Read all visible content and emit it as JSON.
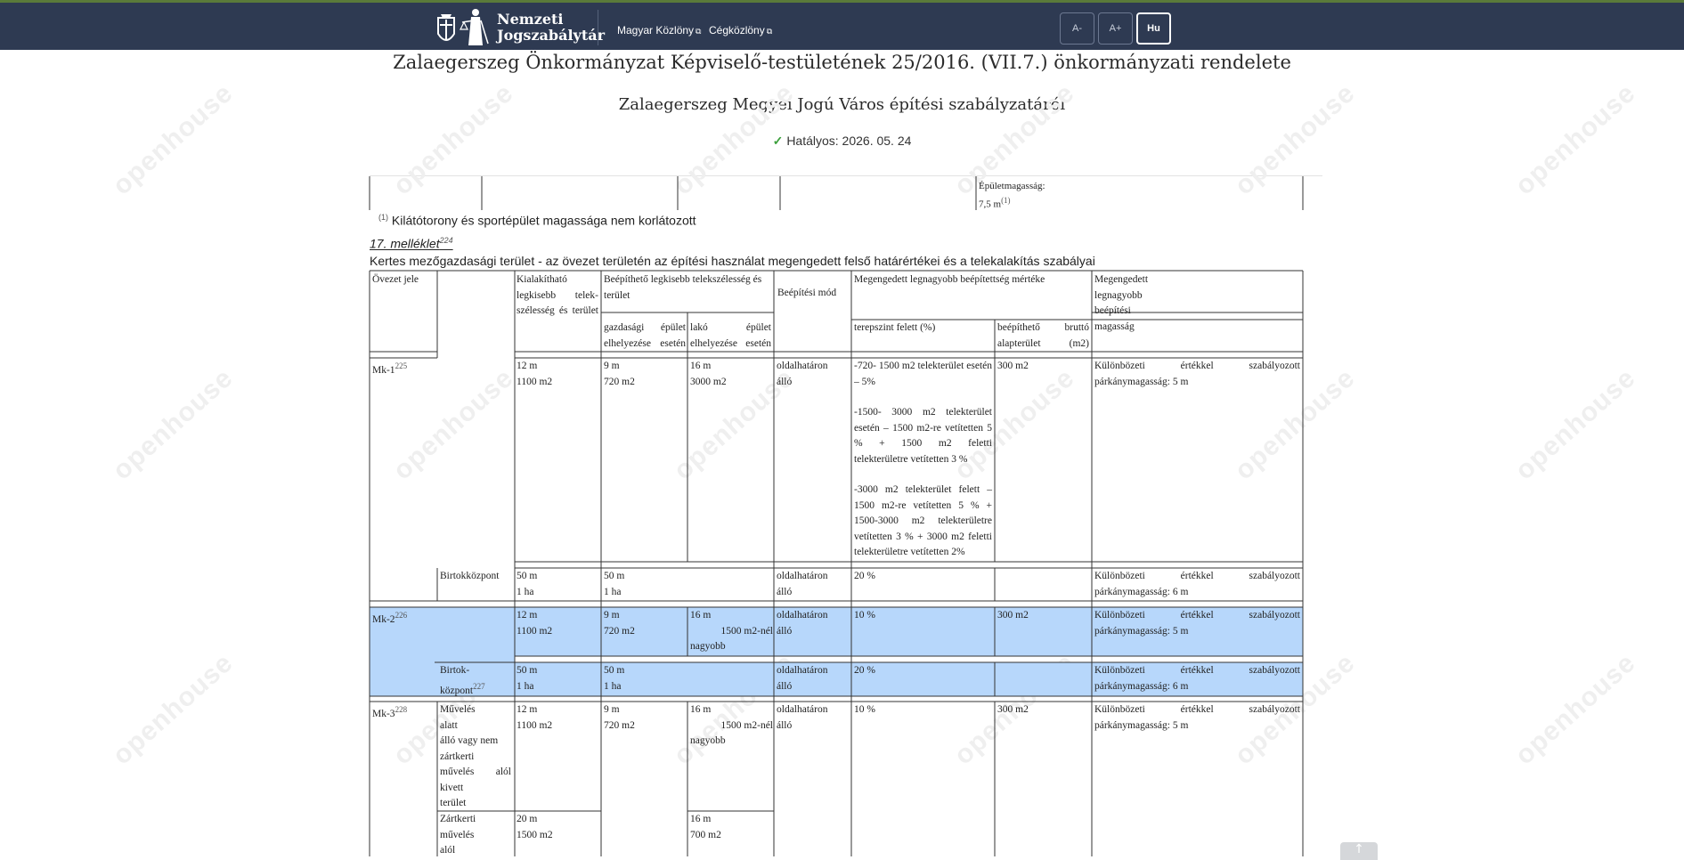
{
  "header": {
    "logo_line1": "Nemzeti",
    "logo_line2": "Jogszabálytár",
    "links": [
      "Magyar Közlöny",
      "Cégközlöny"
    ],
    "font_buttons": [
      "A-",
      "A+",
      "Hu"
    ]
  },
  "document": {
    "title": "Zalaegerszeg Önkormányzat Képviselő-testületének 25/2016. (VII.7.) önkormányzati rendelete",
    "subtitle": "Zalaegerszeg Megyei Jogú Város építési szabályzatáról",
    "status": "Hatályos: 2026. 05. 24"
  },
  "previous_table_tail": {
    "height_label": "Épületmagasság:",
    "height_value": "7,5 m",
    "height_note": "(1)"
  },
  "footnote": {
    "mark": "(1)",
    "text": "Kilátótorony és sportépület magassága nem korlátozott"
  },
  "annex": {
    "label": "17. melléklet",
    "ref": "224",
    "title": "Kertes mezőgazdasági terület - az övezet területén az építési használat megengedett felső határértékei és a telekalakítás szabályai"
  },
  "table": {
    "headers": {
      "zone": "Övezet jele",
      "min_plot": "Kialakítható legkisebb telek-szélesség és terület",
      "buildable": "Beépíthető legkisebb telekszélesség és terület",
      "economic": "gazdasági épület elhelyezése esetén",
      "residential": "lakó épület elhelyezése esetén",
      "mode": "Beépítési mód",
      "max_coverage": "Megengedett legnagyobb beépítettség mértéke",
      "above_ground": "terepszint felett (%)",
      "gross_area": "beépíthető bruttó alapterület (m2)",
      "max_height": "Megengedett legnagyobb beépítési magasság"
    },
    "mk1": {
      "zone": "Mk-1",
      "ref": "225",
      "min_plot": [
        "12 m",
        "1100 m2"
      ],
      "econ": [
        "9 m",
        "720 m2"
      ],
      "resid": [
        "16 m",
        "3000 m2"
      ],
      "mode": [
        "oldalhatáron",
        "álló"
      ],
      "coverage": [
        "-720- 1500 m2 telekterület esetén – 5%",
        "-1500- 3000 m2 telekterület esetén – 1500 m2-re vetítetten 5 % + 1500 m2 feletti telekterületre vetítetten 3 %",
        "-3000 m2 telekterület felett – 1500 m2-re vetítetten 5 % + 1500-3000 m2 telekterületre vetítetten 3 % + 3000 m2 feletti telekterületre vetítetten 2%"
      ],
      "gross": "300 m2",
      "height": [
        "Különbözeti értékkel szabályozott",
        "párkánymagasság: 5 m"
      ],
      "sub": {
        "name": "Birtokközpont",
        "min_plot": [
          "50 m",
          "1 ha"
        ],
        "build": [
          "50 m",
          "1 ha"
        ],
        "mode": [
          "oldalhatáron",
          "álló"
        ],
        "coverage": "20 %",
        "height": [
          "Különbözeti értékkel szabályozott",
          "párkánymagasság: 6 m"
        ]
      }
    },
    "mk2": {
      "zone": "Mk-2",
      "ref": "226",
      "min_plot": [
        "12 m",
        "1100 m2"
      ],
      "econ": [
        "9 m",
        "720 m2"
      ],
      "resid": [
        "16 m",
        "1500 m2-nél",
        "nagyobb"
      ],
      "mode": [
        "oldalhatáron",
        "álló"
      ],
      "coverage": "10 %",
      "gross": "300 m2",
      "height": [
        "Különbözeti értékkel szabályozott",
        "párkánymagasság: 5 m"
      ],
      "sub": {
        "name1": "Birtok-",
        "name2": "központ",
        "ref": "227",
        "min_plot": [
          "50 m",
          "1 ha"
        ],
        "build": [
          "50 m",
          "1 ha"
        ],
        "mode": [
          "oldalhatáron",
          "álló"
        ],
        "coverage": "20 %",
        "height": [
          "Különbözeti értékkel szabályozott",
          "párkánymagasság: 6 m"
        ]
      }
    },
    "mk3": {
      "zone": "Mk-3",
      "ref": "228",
      "sub1": [
        "Művelés",
        "alatt",
        "álló vagy nem",
        "zártkerti",
        "művelés alól",
        "kivett",
        "terület"
      ],
      "min_plot": [
        "12 m",
        "1100 m2"
      ],
      "econ": [
        "9 m",
        "720 m2"
      ],
      "resid": [
        "16 m",
        "1500 m2-nél",
        "nagyobb"
      ],
      "mode": [
        "oldalhatáron",
        "álló"
      ],
      "coverage": "10 %",
      "gross": "300 m2",
      "height": [
        "Különbözeti értékkel szabályozott",
        "párkánymagasság: 5 m"
      ],
      "sub2": [
        "Zártkerti",
        "művelés",
        "alól"
      ],
      "sub2_min_plot": [
        "20 m",
        "1500 m2"
      ],
      "sub2_resid": [
        "16 m",
        "700 m2"
      ]
    }
  },
  "watermark": "openhouse"
}
